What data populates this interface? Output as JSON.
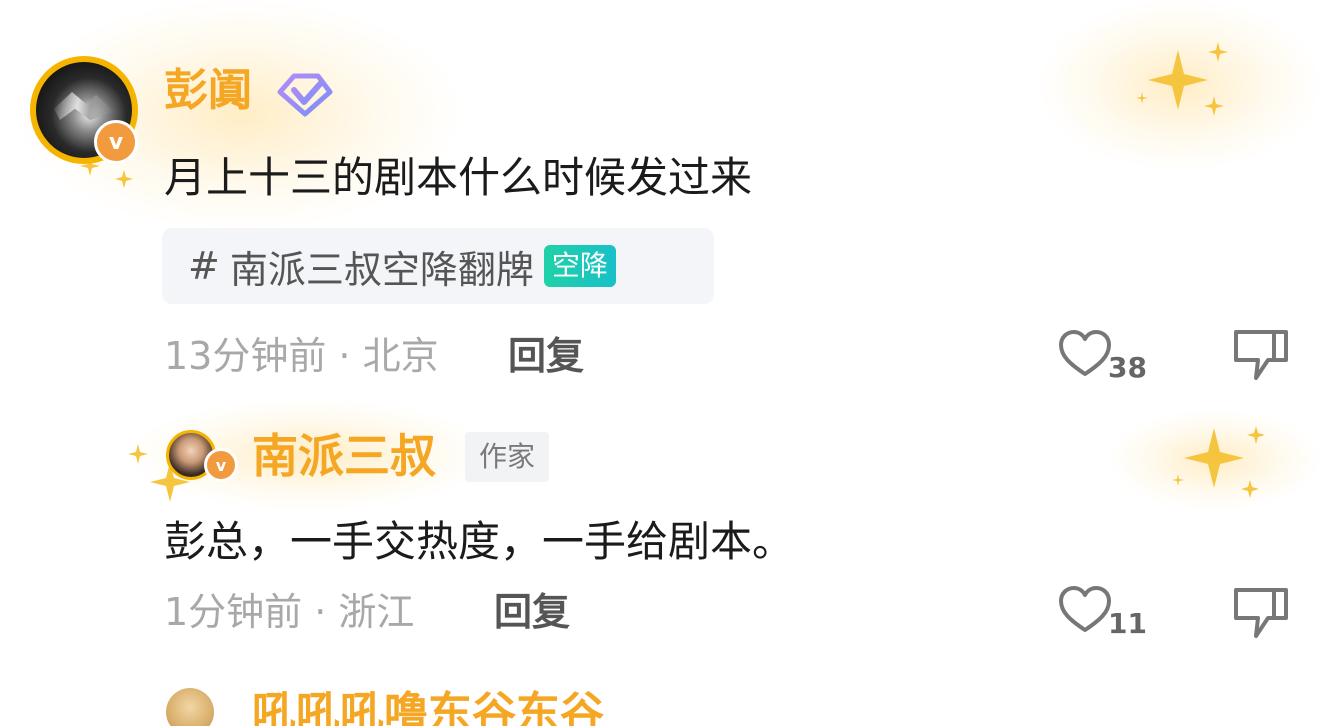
{
  "accent_color": "#f5a623",
  "comments": [
    {
      "username": "彭阗",
      "content": "月上十三的剧本什么时候发过来",
      "topic": {
        "hash": "#",
        "text": "南派三叔空降翻牌",
        "badge": "空降"
      },
      "time_location": "13分钟前 · 北京",
      "reply_label": "回复",
      "likes": "38",
      "avatar_badge": "v",
      "vip_icon": "diamond-vip-icon"
    },
    {
      "username": "南派三叔",
      "role": "作家",
      "content": "彭总，一手交热度，一手给剧本。",
      "time_location": "1分钟前 · 浙江",
      "reply_label": "回复",
      "likes": "11",
      "avatar_badge": "v"
    }
  ],
  "next_comment": {
    "username": "吼吼吼噜东谷东谷"
  }
}
